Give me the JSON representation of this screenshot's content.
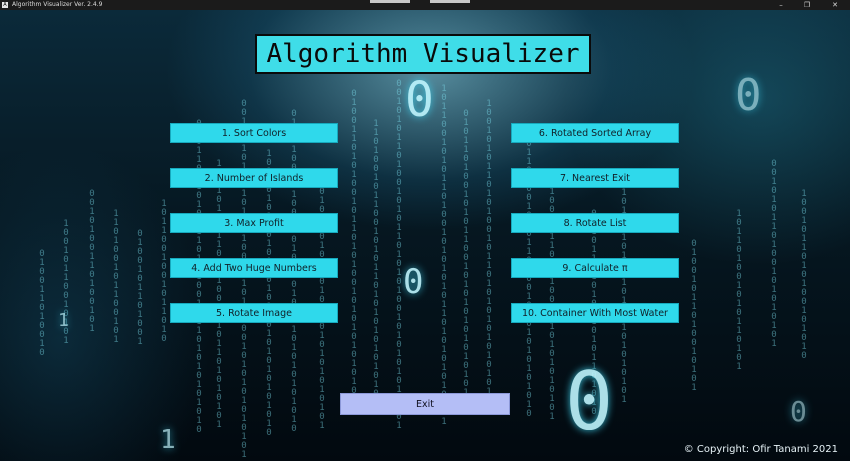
{
  "window": {
    "title": "Algorithm Visualizer Ver. 2.4.9",
    "icon_glyph": "A",
    "controls": {
      "minimize": "–",
      "maximize": "❐",
      "close": "✕"
    }
  },
  "app": {
    "title": "Algorithm Visualizer",
    "left_buttons": [
      "1. Sort Colors",
      "2. Number of Islands",
      "3. Max Profit",
      "4. Add Two Huge Numbers",
      "5. Rotate Image"
    ],
    "right_buttons": [
      "6. Rotated Sorted Array",
      "7. Nearest Exit",
      "8. Rotate List",
      "9. Calculate π",
      "10. Container With Most Water"
    ],
    "exit_label": "Exit",
    "copyright": "© Copyright: Ofir Tanami 2021"
  },
  "colors": {
    "title_bg": "#3fdde8",
    "button_bg": "#2fd9eb",
    "exit_bg": "#b4bef6",
    "background": "#02080d"
  },
  "icons": {
    "app_icon": "app-logo-icon",
    "minimize": "minimize-icon",
    "maximize": "maximize-icon",
    "close": "close-icon"
  }
}
